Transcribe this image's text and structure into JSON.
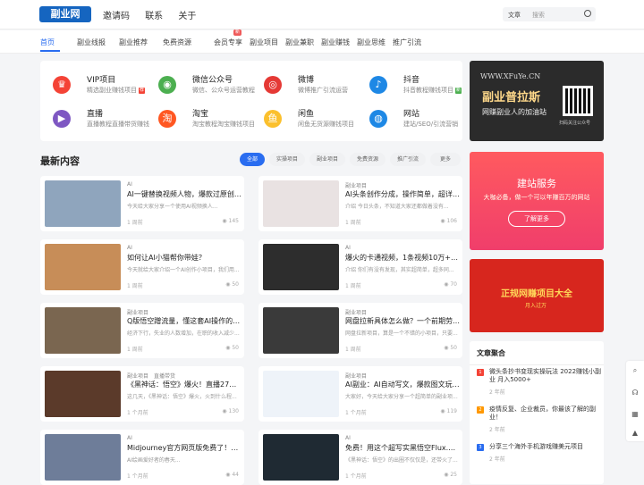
{
  "brand": {
    "logo_text": "副业网",
    "accent": "#2a6df0"
  },
  "topnav": [
    "邀请码",
    "联系",
    "关于"
  ],
  "search": {
    "category": "文章",
    "placeholder": "搜索"
  },
  "subnav": [
    {
      "label": "首页",
      "active": true
    },
    {
      "label": "副业线报"
    },
    {
      "label": "副业推荐"
    },
    {
      "label": "免费资源"
    },
    {
      "label": "会员专享",
      "badge": "新"
    },
    {
      "label": "副业项目"
    },
    {
      "label": "副业兼职"
    },
    {
      "label": "副业赚钱"
    },
    {
      "label": "副业思维"
    },
    {
      "label": "推广引流"
    }
  ],
  "categories": [
    {
      "title": "VIP项目",
      "desc": "精选副业赚钱项目",
      "icon": "crown-icon",
      "color": "#f44336",
      "tag": "荐"
    },
    {
      "title": "微信公众号",
      "desc": "微信、公众号运营教程",
      "icon": "wechat-icon",
      "color": "#4caf50"
    },
    {
      "title": "微博",
      "desc": "微博推广引流运营",
      "icon": "weibo-icon",
      "color": "#e53935"
    },
    {
      "title": "抖音",
      "desc": "抖音教程赚钱项目",
      "icon": "tiktok-icon",
      "color": "#1e88e5",
      "tag": "新"
    },
    {
      "title": "直播",
      "desc": "直播教程直播带货赚钱",
      "icon": "live-icon",
      "color": "#7e57c2"
    },
    {
      "title": "淘宝",
      "desc": "淘宝教程淘宝赚钱项目",
      "icon": "taobao-icon",
      "color": "#ff5722"
    },
    {
      "title": "闲鱼",
      "desc": "闲鱼无货源赚钱项目",
      "icon": "xianyu-icon",
      "color": "#fbc02d"
    },
    {
      "title": "网站",
      "desc": "建站/SEO/引流营销",
      "icon": "globe-icon",
      "color": "#1e88e5"
    }
  ],
  "latest": {
    "title": "最新内容",
    "filters": [
      "全部",
      "实操项目",
      "副业项目",
      "免费资源",
      "推广引流",
      "更多"
    ],
    "posts": [
      {
        "cat": "AI",
        "title": "AI一键替换视频人物，爆款过原创，...",
        "excerpt": "今天给大家分享一个使用AI视频换人...",
        "time": "1 周前",
        "views": "145",
        "thumb": "#8fa5bd"
      },
      {
        "cat": "副业项目",
        "title": "AI头条创作分成，操作简单，超详细...",
        "excerpt": "介绍 今日头条，不知道大家还都做着没有...",
        "time": "1 周前",
        "views": "106",
        "thumb": "#e9e2e2"
      },
      {
        "cat": "AI",
        "title": "如何让AI小猫帮你带娃？",
        "excerpt": "今天就给大家介绍一个AI创作小项目，我们用...",
        "time": "1 周前",
        "views": "50",
        "thumb": "#c78d58"
      },
      {
        "cat": "AI",
        "title": "爆火的卡通视频，1条视频10万+点...",
        "excerpt": "介绍 你们有没有发现，其实超简单，超多同...",
        "time": "1 周前",
        "views": "70",
        "thumb": "#2d2d2d"
      },
      {
        "cat": "副业项目",
        "title": "Q版悟空蹭流量，懂这套AI操作的人...",
        "excerpt": "经济下行，失业的人数增加，在职的收入减少...",
        "time": "1 周前",
        "views": "50",
        "thumb": "#7a6650"
      },
      {
        "cat": "副业项目",
        "title": "网盘拉新具体怎么做？一个前期劳苦...",
        "excerpt": "网盘拉新项目，算是一个不错的小项目，只要...",
        "time": "1 周前",
        "views": "50",
        "thumb": "#3a3a3a"
      },
      {
        "cat": "副业项目",
        "cat2": "直播带货",
        "title": "《黑神话：悟空》爆火！直播27小时...",
        "excerpt": "这几天，《黑神话：悟空》爆火，火到什么程...",
        "time": "1 个月前",
        "views": "130",
        "thumb": "#5b3a2a"
      },
      {
        "cat": "副业项目",
        "title": "AI副业：AI自动写文，爆款图文玩法...",
        "excerpt": "大家好，今天给大家分享一个超简单的副业项...",
        "time": "1 个月前",
        "views": "119",
        "thumb": "#eef3f9"
      },
      {
        "cat": "AI",
        "title": "Midjourney官方网页版免费了！！！",
        "excerpt": "AI绘画爱好者的春天...",
        "time": "1 个月前",
        "views": "44",
        "thumb": "#6e7d99"
      },
      {
        "cat": "AI",
        "title": "免费！用这个超写实黑悟空Flux.1模...",
        "excerpt": "《黑神话：悟空》的出圈不仅仅是，还带火了...",
        "time": "1 个月前",
        "views": "25",
        "thumb": "#1f2a33"
      }
    ]
  },
  "ad1": {
    "url": "WWW.XFuYe.CN",
    "headline": "副业普拉斯",
    "slogan": "网赚副业人的加油站",
    "qr_label": "扫码关注公众号"
  },
  "ad2": {
    "headline": "建站服务",
    "sub": "大咖必备，做一个可以年赚百万的网站",
    "button": "了解更多"
  },
  "ad3": {
    "headline": "正规网赚项目大全",
    "sub": "月入过万"
  },
  "aggregate": {
    "title": "文章聚合",
    "items": [
      {
        "n": "1",
        "title": "微头条抄书变现实操玩法 2022赚钱小副业 月入5000+",
        "time": "2 年前",
        "color": "#f44336"
      },
      {
        "n": "2",
        "title": "疫情反复、企业裁员，你最该了解的副业！",
        "time": "2 年前",
        "color": "#ff9800"
      },
      {
        "n": "3",
        "title": "分享三个海外手机游戏赚美元项目",
        "time": "2 年前",
        "color": "#2a6df0"
      }
    ]
  }
}
